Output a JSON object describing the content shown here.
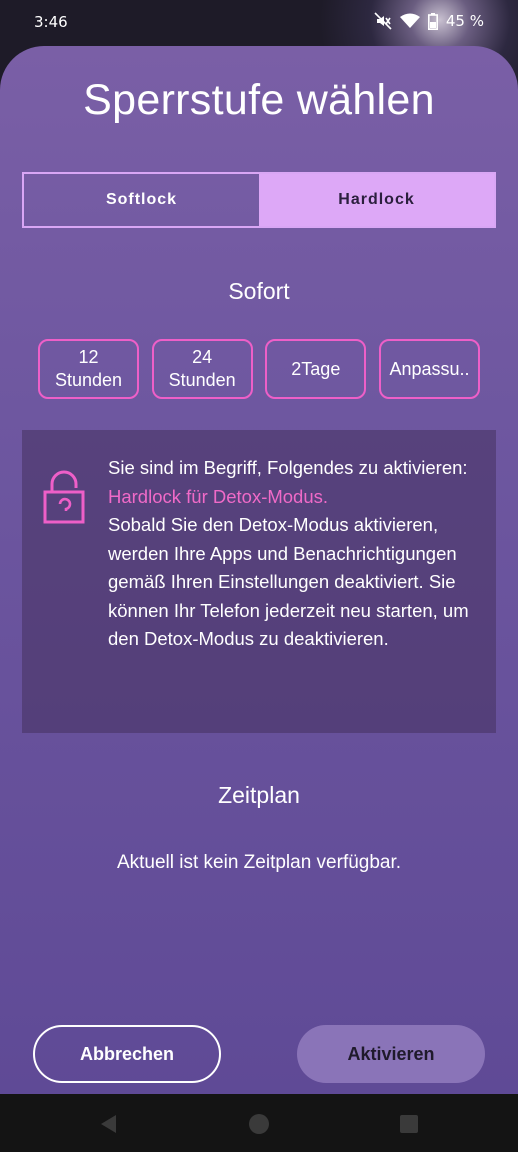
{
  "status_bar": {
    "time": "3:46",
    "battery": "45 %",
    "icons": [
      "mute-icon",
      "wifi-icon",
      "battery-icon"
    ]
  },
  "dialog": {
    "title": "Sperrstufe wählen",
    "tabs": [
      {
        "label": "Softlock",
        "selected": false
      },
      {
        "label": "Hardlock",
        "selected": true
      }
    ],
    "immediate_label": "Sofort",
    "durations": [
      {
        "label": "12\nStunden"
      },
      {
        "label": "24\nStunden"
      },
      {
        "label": "2Tage"
      },
      {
        "label": "Anpassu.."
      }
    ],
    "info": {
      "icon": "lock-icon",
      "intro": "Sie sind im Begriff, Folgendes zu aktivieren:",
      "highlight": "Hardlock für Detox-Modus.",
      "body": "Sobald Sie den Detox-Modus aktivieren, werden Ihre Apps und Benachrichtigungen gemäß Ihren Einstellungen deaktiviert. Sie können Ihr Telefon jederzeit neu starten, um den Detox-Modus zu deaktivieren."
    },
    "schedule_label": "Zeitplan",
    "schedule_empty": "Aktuell ist kein Zeitplan verfügbar.",
    "cancel_label": "Abbrechen",
    "activate_label": "Aktivieren"
  },
  "colors": {
    "accent_pink": "#ee5fc8",
    "tab_selected": "#dda8f7",
    "sheet": "#6e57a0"
  }
}
